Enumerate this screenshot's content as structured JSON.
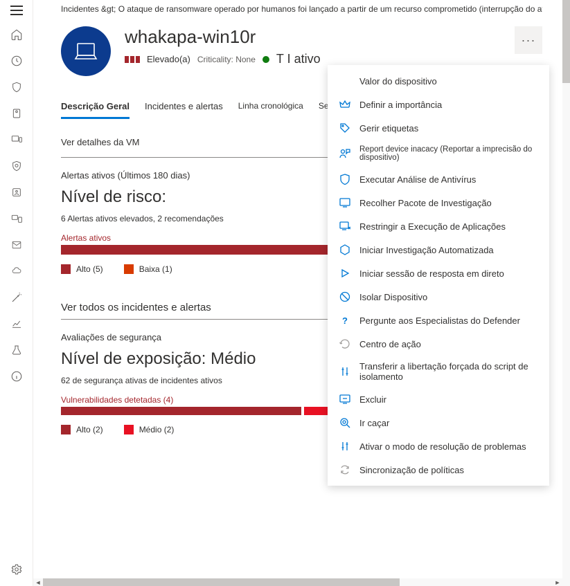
{
  "breadcrumb": "Incidentes &gt;   O ataque de ransomware operado por humanos foi lançado a partir de um recurso comprometido (interrupção do ataque) &gt;",
  "device": {
    "name": "whakapa-win10r",
    "risk_label": "Elevado(a)",
    "criticality": "Criticality: None",
    "status_text": "T I ativo"
  },
  "tabs": {
    "t0": "Descrição Geral",
    "t1": "Incidentes e alertas",
    "t2": "Linha cronológica",
    "t3": "Segurança"
  },
  "vm_link": "Ver detalhes da VM",
  "alerts_section": {
    "header": "Alertas ativos (Últimos 180 dias)",
    "risk_title": "Nível de risco:",
    "summary": "6 Alertas ativos elevados, 2 recomendações",
    "bar_label": "Alertas ativos",
    "legend_high": "Alto (5)",
    "legend_low": "Baixa (1)"
  },
  "view_all": "Ver todos os incidentes e alertas",
  "sec_section": {
    "header": "Avaliações de segurança",
    "title": "Nível de exposição: Médio",
    "summary": "62 de segurança ativas de incidentes ativos",
    "vuln_label": "Vulnerabilidades detetadas (4)",
    "legend_high": "Alto (2)",
    "legend_med": "Médio (2)"
  },
  "menu": {
    "m0": "Valor do dispositivo",
    "m1": "Definir a importância",
    "m2": "Gerir etiquetas",
    "m3": "Report device inacacy (Reportar a imprecisão do dispositivo)",
    "m4": "Executar Análise de Antivírus",
    "m5": "Recolher Pacote de Investigação",
    "m6": "Restringir a Execução de Aplicações",
    "m7": "Iniciar Investigação Automatizada",
    "m8": "Iniciar sessão de resposta em direto",
    "m9": "Isolar Dispositivo",
    "m10": "Pergunte aos Especialistas do Defender",
    "m11": "Centro de ação",
    "m12": "Transferir a libertação forçada do script de isolamento",
    "m13": "Excluir",
    "m14": "Ir caçar",
    "m15": "Ativar o modo de resolução de problemas",
    "m16": "Sincronização de políticas"
  }
}
